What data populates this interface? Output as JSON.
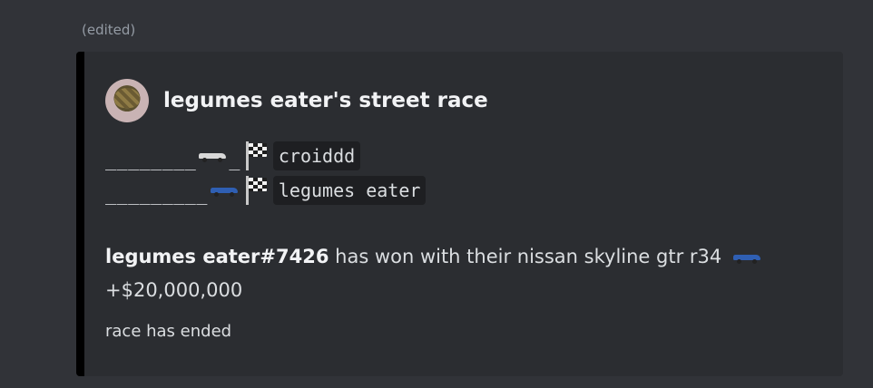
{
  "message": {
    "edited_label": "(edited)"
  },
  "embed": {
    "accent_color": "#000000",
    "author_name": "legumes eater's street race",
    "race": [
      {
        "track": "________",
        "track_after": "_",
        "car_icon": "white-race-car-icon",
        "flag_icon": "checkered-flag-icon",
        "racer": "croiddd"
      },
      {
        "track": "_________",
        "car_icon": "blue-car-icon",
        "flag_icon": "checkered-flag-icon",
        "racer": "legumes eater"
      }
    ],
    "result": {
      "winner": "legumes eater#7426",
      "text": "has won with their nissan skyline gtr r34",
      "car_icon": "blue-car-icon",
      "prize": "+$20,000,000"
    },
    "footer": "race has ended"
  }
}
